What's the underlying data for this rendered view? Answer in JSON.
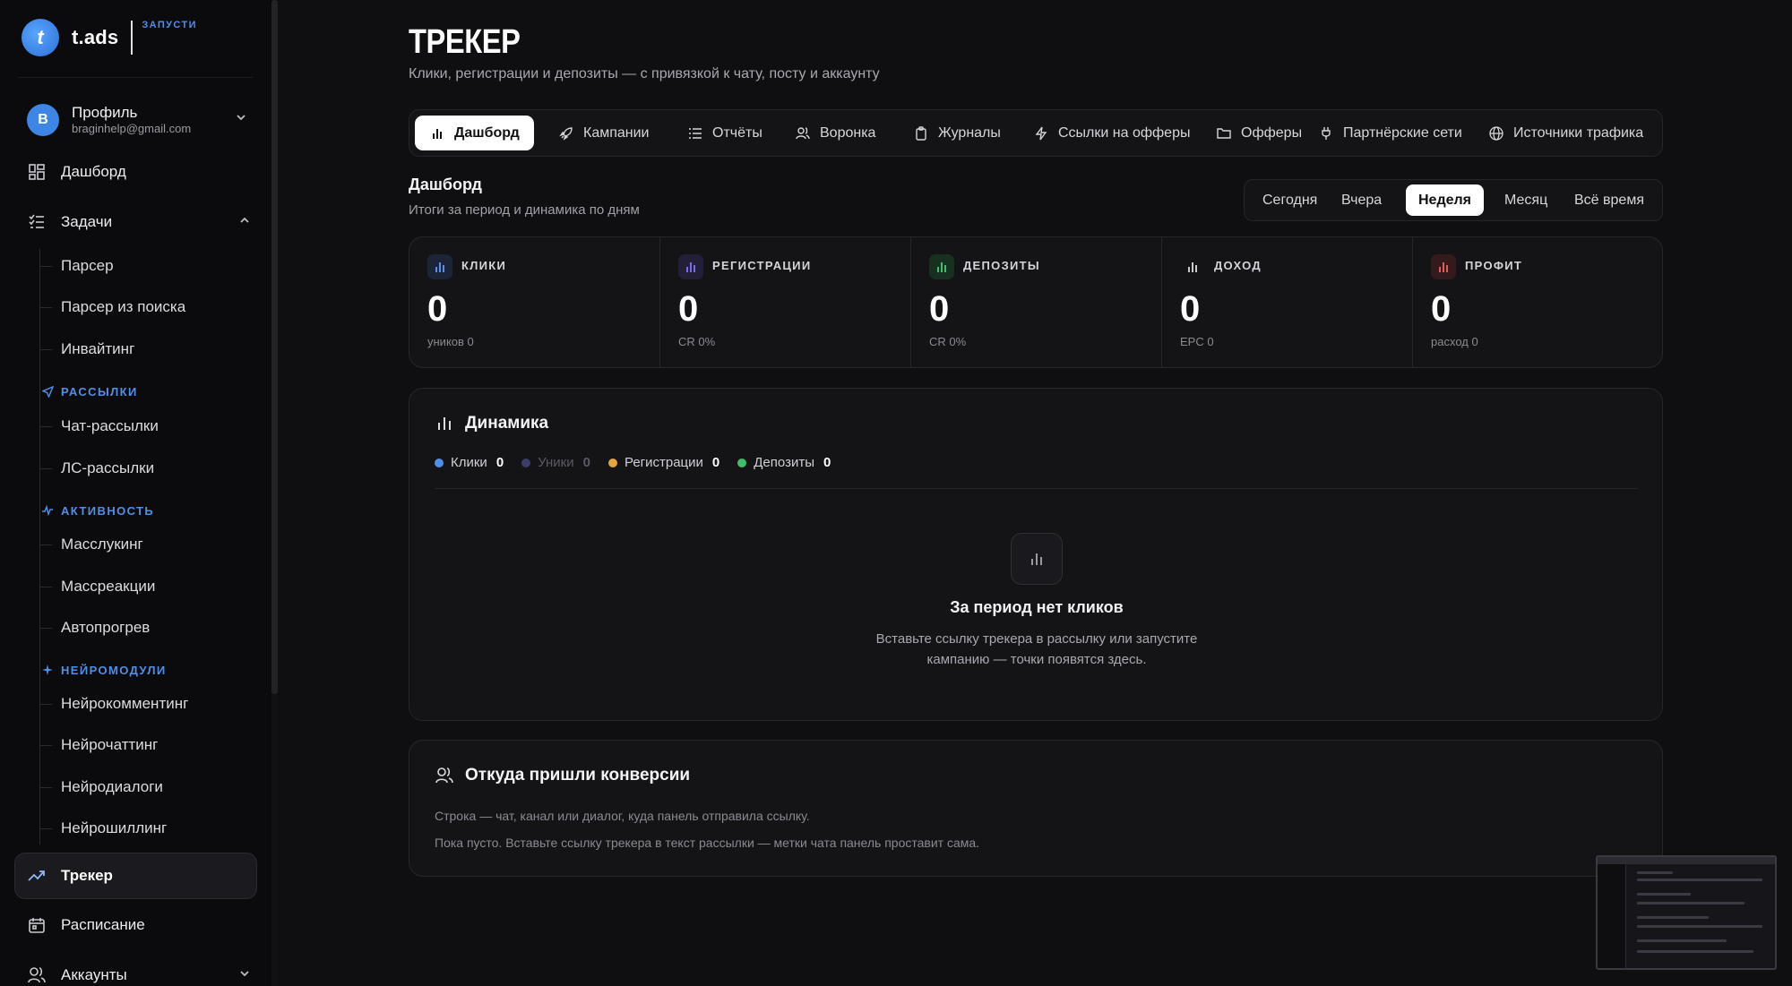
{
  "brand": {
    "logo_letter": "t",
    "name": "t.ads",
    "tag": "ЗАПУСТИ"
  },
  "profile": {
    "avatar_letter": "B",
    "name": "Профиль",
    "email": "braginhelp@gmail.com"
  },
  "sidebar": {
    "dashboard": "Дашборд",
    "tasks": "Задачи",
    "tasks_items": [
      "Парсер",
      "Парсер из поиска",
      "Инвайтинг"
    ],
    "mailing_section": "РАССЫЛКИ",
    "mailing_items": [
      "Чат-рассылки",
      "ЛС-рассылки"
    ],
    "activity_section": "АКТИВНОСТЬ",
    "activity_items": [
      "Масслукинг",
      "Массреакции",
      "Автопрогрев"
    ],
    "neuro_section": "НЕЙРОМОДУЛИ",
    "neuro_items": [
      "Нейрокомментинг",
      "Нейрочаттинг",
      "Нейродиалоги",
      "Нейрошиллинг"
    ],
    "tracker": "Трекер",
    "schedule": "Расписание",
    "accounts": "Аккаунты"
  },
  "header": {
    "title": "ТРЕКЕР",
    "subtitle": "Клики, регистрации и депозиты — с привязкой к чату, посту и аккаунту"
  },
  "tabs": [
    {
      "label": "Дашборд",
      "icon": "bar-chart-icon"
    },
    {
      "label": "Кампании",
      "icon": "rocket-icon"
    },
    {
      "label": "Отчёты",
      "icon": "list-icon"
    },
    {
      "label": "Воронка",
      "icon": "users-icon"
    },
    {
      "label": "Журналы",
      "icon": "clipboard-icon"
    },
    {
      "label": "Ссылки на офферы",
      "icon": "lightning-icon"
    },
    {
      "label": "Офферы",
      "icon": "folder-icon"
    },
    {
      "label": "Партнёрские сети",
      "icon": "plug-icon"
    },
    {
      "label": "Источники трафика",
      "icon": "globe-icon"
    }
  ],
  "section": {
    "title": "Дашборд",
    "subtitle": "Итоги за период и динамика по дням"
  },
  "periods": [
    "Сегодня",
    "Вчера",
    "Неделя",
    "Месяц",
    "Всё время"
  ],
  "stats": [
    {
      "label": "КЛИКИ",
      "value": "0",
      "sub": "уников 0",
      "color": "#5b8def"
    },
    {
      "label": "РЕГИСТРАЦИИ",
      "value": "0",
      "sub": "CR 0%",
      "color": "#7a6be8"
    },
    {
      "label": "ДЕПОЗИТЫ",
      "value": "0",
      "sub": "CR 0%",
      "color": "#3fbf6e"
    },
    {
      "label": "ДОХОД",
      "value": "0",
      "sub": "EPC 0",
      "color": "#c9c9cf"
    },
    {
      "label": "ПРОФИТ",
      "value": "0",
      "sub": "расход 0",
      "color": "#e05a5a"
    }
  ],
  "dynamics": {
    "title": "Динамика",
    "legend": [
      {
        "name": "Клики",
        "value": "0",
        "color": "#4f8fe6"
      },
      {
        "name": "Уники",
        "value": "0",
        "color": "#3d3d6a"
      },
      {
        "name": "Регистрации",
        "value": "0",
        "color": "#e8a33d"
      },
      {
        "name": "Депозиты",
        "value": "0",
        "color": "#3fbf6e"
      }
    ],
    "empty_title": "За период нет кликов",
    "empty_text_1": "Вставьте ссылку трекера в рассылку или запустите",
    "empty_text_2": "кампанию — точки появятся здесь."
  },
  "conversions": {
    "title": "Откуда пришли конверсии",
    "text_1": "Строка — чат, канал или диалог, куда панель отправила ссылку.",
    "text_2": "Пока пусто. Вставьте ссылку трекера в текст рассылки — метки чата панель проставит сама."
  }
}
